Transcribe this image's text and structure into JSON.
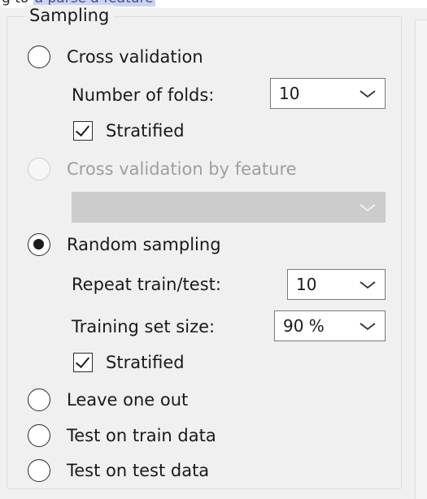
{
  "window_title": {
    "prefix": "g to ",
    "highlight": "a parse a feature"
  },
  "sampling": {
    "title": "Sampling",
    "cross_validation": {
      "label": "Cross validation",
      "checked": false,
      "folds_label": "Number of folds:",
      "folds_value": "10",
      "stratified_label": "Stratified",
      "stratified_checked": true
    },
    "cross_validation_by_feature": {
      "label": "Cross validation by feature",
      "enabled": false,
      "feature_value": ""
    },
    "random_sampling": {
      "label": "Random sampling",
      "checked": true,
      "repeat_label": "Repeat train/test:",
      "repeat_value": "10",
      "training_size_label": "Training set size:",
      "training_size_value": "90 %",
      "stratified_label": "Stratified",
      "stratified_checked": true
    },
    "leave_one_out": {
      "label": "Leave one out",
      "checked": false
    },
    "test_on_train": {
      "label": "Test on train data",
      "checked": false
    },
    "test_on_test": {
      "label": "Test on test data",
      "checked": false
    }
  },
  "colors": {
    "background": "#f0f0f0",
    "border": "#dcdcdc",
    "disabled_text": "#9e9e9e",
    "disabled_combo": "#cccccc"
  }
}
